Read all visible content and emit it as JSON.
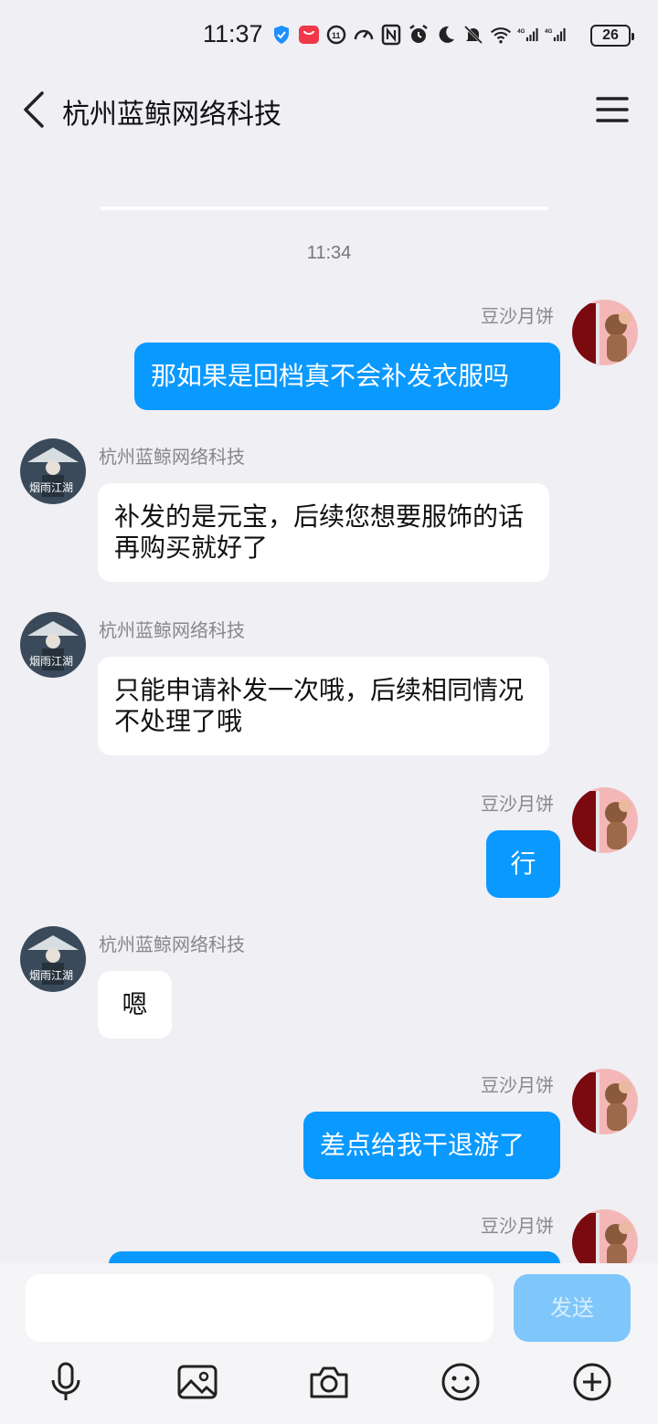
{
  "status_bar": {
    "time": "11:37",
    "battery": "26"
  },
  "header": {
    "title": "杭州蓝鲸网络科技"
  },
  "chat": {
    "timestamp": "11:34",
    "messages": [
      {
        "sender": "豆沙月饼",
        "text": "那如果是回档真不会补发衣服吗"
      },
      {
        "sender": "杭州蓝鲸网络科技",
        "text": "补发的是元宝，后续您想要服饰的话再购买就好了"
      },
      {
        "sender": "杭州蓝鲸网络科技",
        "text": "只能申请补发一次哦，后续相同情况不处理了哦"
      },
      {
        "sender": "豆沙月饼",
        "text": "行"
      },
      {
        "sender": "杭州蓝鲸网络科技",
        "text": "嗯"
      },
      {
        "sender": "豆沙月饼",
        "text": "差点给我干退游了"
      },
      {
        "sender": "豆沙月饼",
        "text": ""
      }
    ]
  },
  "input": {
    "placeholder": "",
    "send_label": "发送"
  },
  "colors": {
    "outgoing_bubble": "#0a99ff",
    "incoming_bubble": "#ffffff",
    "send_button": "#7fc6fb"
  },
  "icons": [
    "voice-icon",
    "image-icon",
    "camera-icon",
    "emoji-icon",
    "plus-icon"
  ]
}
